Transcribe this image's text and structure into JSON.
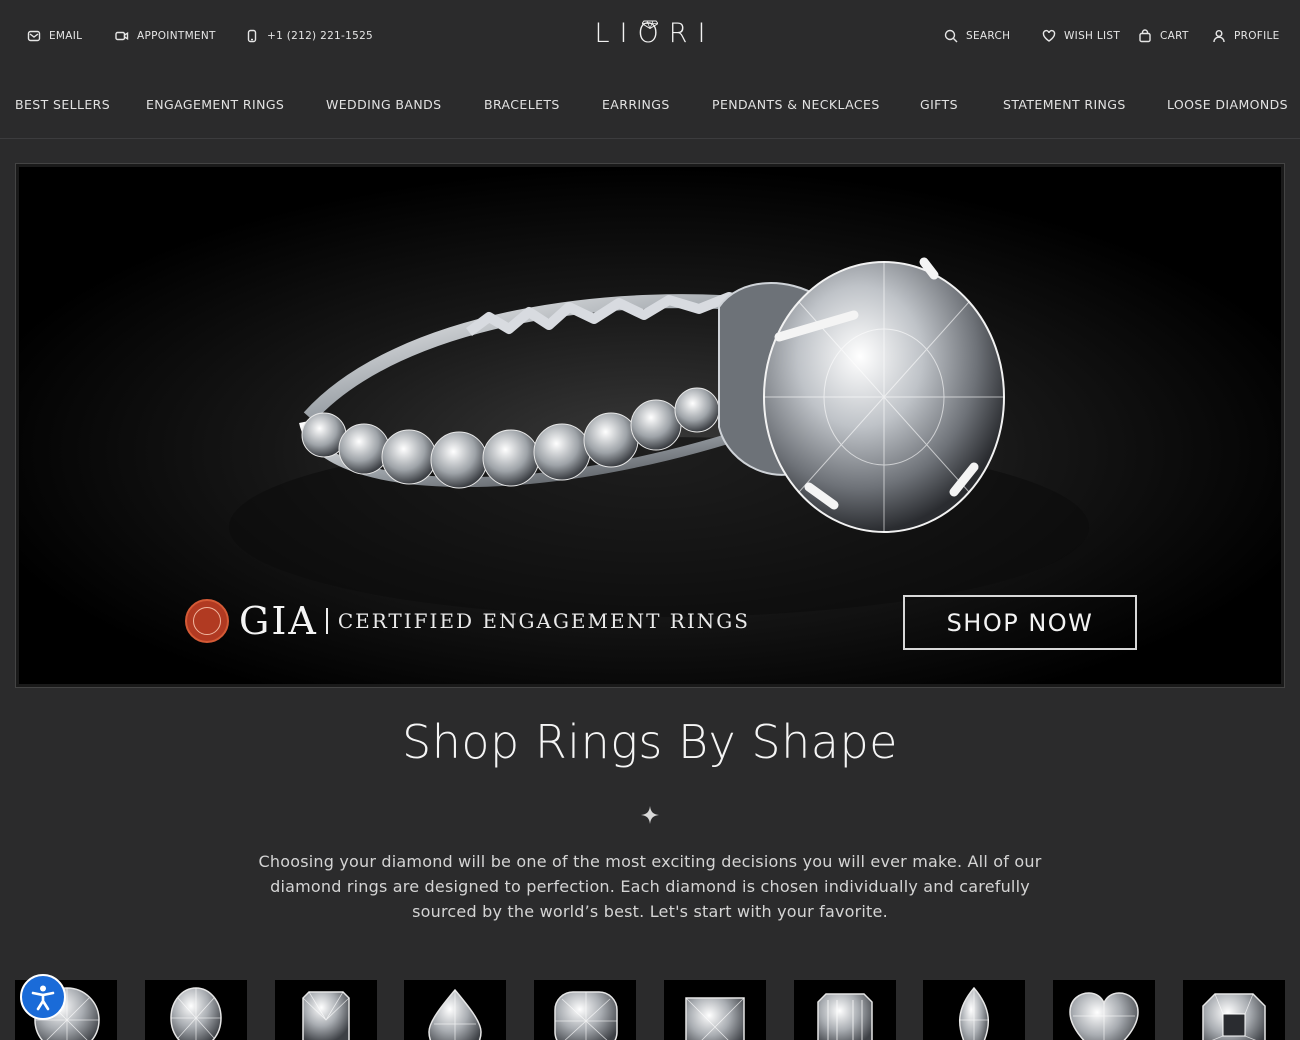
{
  "topbar": {
    "email_label": "EMAIL",
    "appointment_label": "APPOINTMENT",
    "phone_label": "+1 (212) 221-1525",
    "logo_text": "LIORI",
    "search_label": "SEARCH",
    "wishlist_label": "WISH LIST",
    "cart_label": "CART",
    "profile_label": "PROFILE"
  },
  "nav": {
    "items": [
      "BEST SELLERS",
      "ENGAGEMENT RINGS",
      "WEDDING BANDS",
      "BRACELETS",
      "EARRINGS",
      "PENDANTS & NECKLACES",
      "GIFTS",
      "STATEMENT RINGS",
      "LOOSE DIAMONDS"
    ]
  },
  "hero": {
    "gia_label": "GIA",
    "gia_subtitle": "CERTIFIED ENGAGEMENT RINGS",
    "cta_label": "SHOP NOW"
  },
  "section": {
    "title": "Shop Rings By Shape",
    "description": "Choosing your diamond will be one of the most exciting decisions you will ever make. All of our diamond rings are designed to perfection. Each diamond is chosen individually and carefully sourced by the world’s best. Let's start with your favorite."
  },
  "shapes": {
    "icons": [
      "round-diamond-icon",
      "oval-diamond-icon",
      "radiant-diamond-icon",
      "pear-diamond-icon",
      "cushion-diamond-icon",
      "princess-diamond-icon",
      "emerald-diamond-icon",
      "marquise-diamond-icon",
      "heart-diamond-icon",
      "asscher-diamond-icon"
    ]
  },
  "colors": {
    "page_bg": "#2b2b2c",
    "hero_bg": "#000000",
    "gia_seal": "#b13a22",
    "accessibility_button": "#1a6bd8"
  }
}
